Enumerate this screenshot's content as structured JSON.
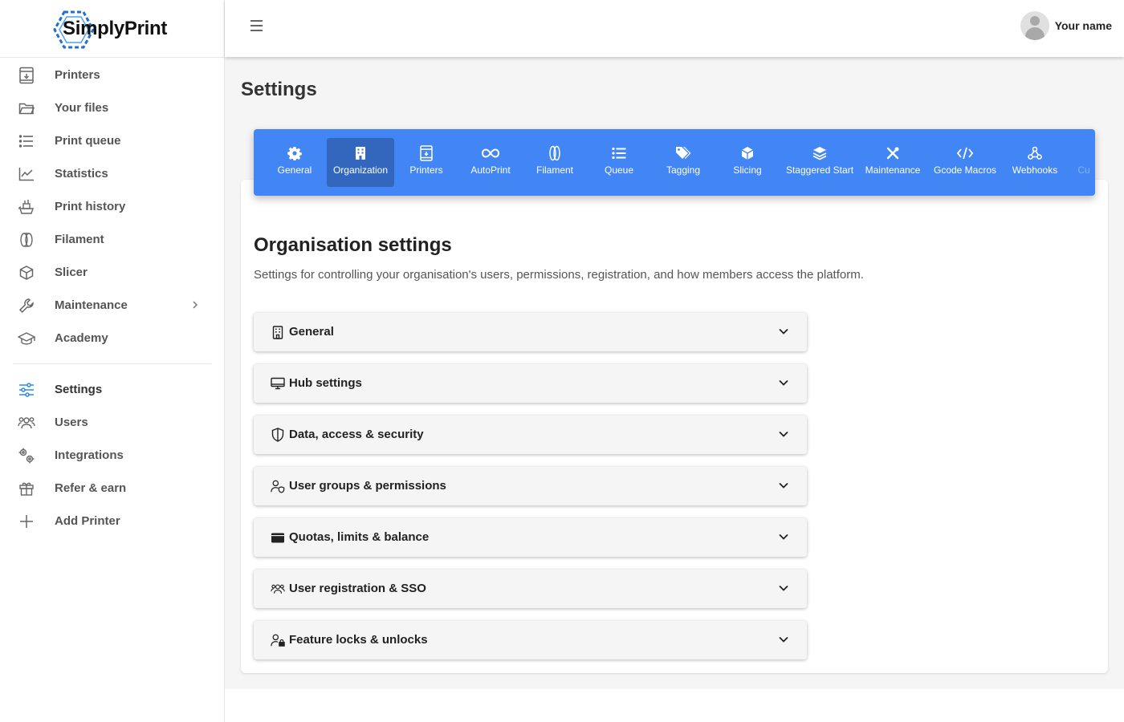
{
  "app": {
    "name": "SimplyPrint",
    "brand_color": "#1f6fd1",
    "accent": "#4285f4"
  },
  "sidebar": {
    "items": [
      {
        "label": "Printers",
        "icon": "printer-icon"
      },
      {
        "label": "Your files",
        "icon": "folder-icon"
      },
      {
        "label": "Print queue",
        "icon": "list-icon"
      },
      {
        "label": "Statistics",
        "icon": "chart-line-icon"
      },
      {
        "label": "Print history",
        "icon": "history-icon"
      },
      {
        "label": "Filament",
        "icon": "filament-icon"
      },
      {
        "label": "Slicer",
        "icon": "cube-icon"
      },
      {
        "label": "Maintenance",
        "icon": "wrench-icon"
      },
      {
        "label": "Academy",
        "icon": "graduation-cap-icon"
      }
    ],
    "items2": [
      {
        "label": "Settings",
        "icon": "sliders-icon",
        "active": true
      },
      {
        "label": "Users",
        "icon": "users-icon"
      },
      {
        "label": "Integrations",
        "icon": "gears-icon"
      },
      {
        "label": "Refer & earn",
        "icon": "gift-icon"
      },
      {
        "label": "Add Printer",
        "icon": "plus-icon"
      }
    ]
  },
  "topbar": {
    "user_name": "Your name"
  },
  "main": {
    "page_title": "Settings",
    "tabs": [
      {
        "label": "General",
        "icon": "gear-icon"
      },
      {
        "label": "Organization",
        "icon": "building-icon",
        "active": true
      },
      {
        "label": "Printers",
        "icon": "printer-icon"
      },
      {
        "label": "AutoPrint",
        "icon": "infinity-icon"
      },
      {
        "label": "Filament",
        "icon": "filament-icon"
      },
      {
        "label": "Queue",
        "icon": "list-icon"
      },
      {
        "label": "Tagging",
        "icon": "tags-icon"
      },
      {
        "label": "Slicing",
        "icon": "cube-icon"
      },
      {
        "label": "Staggered Start",
        "icon": "layers-icon"
      },
      {
        "label": "Maintenance",
        "icon": "tools-icon"
      },
      {
        "label": "Gcode Macros",
        "icon": "code-icon"
      },
      {
        "label": "Webhooks",
        "icon": "webhook-icon"
      },
      {
        "label": "Cu",
        "icon": ""
      }
    ],
    "section_title": "Organisation settings",
    "section_desc": "Settings for controlling your organisation's users, permissions, registration, and how members access the platform.",
    "accordions": [
      {
        "label": "General",
        "icon": "building-icon"
      },
      {
        "label": "Hub settings",
        "icon": "monitor-icon"
      },
      {
        "label": "Data, access & security",
        "icon": "shield-icon"
      },
      {
        "label": "User groups & permissions",
        "icon": "user-shield-icon"
      },
      {
        "label": "Quotas, limits & balance",
        "icon": "wallet-icon"
      },
      {
        "label": "User registration & SSO",
        "icon": "users-icon"
      },
      {
        "label": "Feature locks & unlocks",
        "icon": "user-lock-icon"
      }
    ]
  }
}
